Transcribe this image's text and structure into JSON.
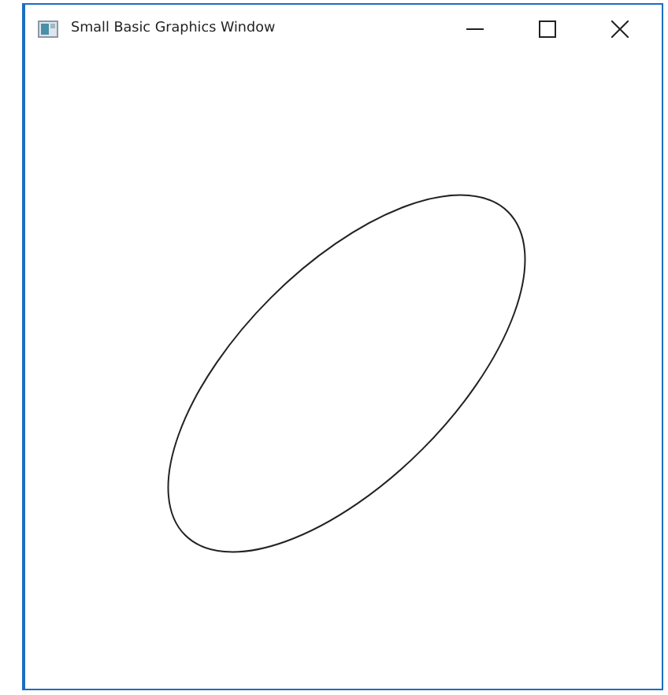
{
  "window": {
    "title": "Small Basic Graphics Window"
  }
}
